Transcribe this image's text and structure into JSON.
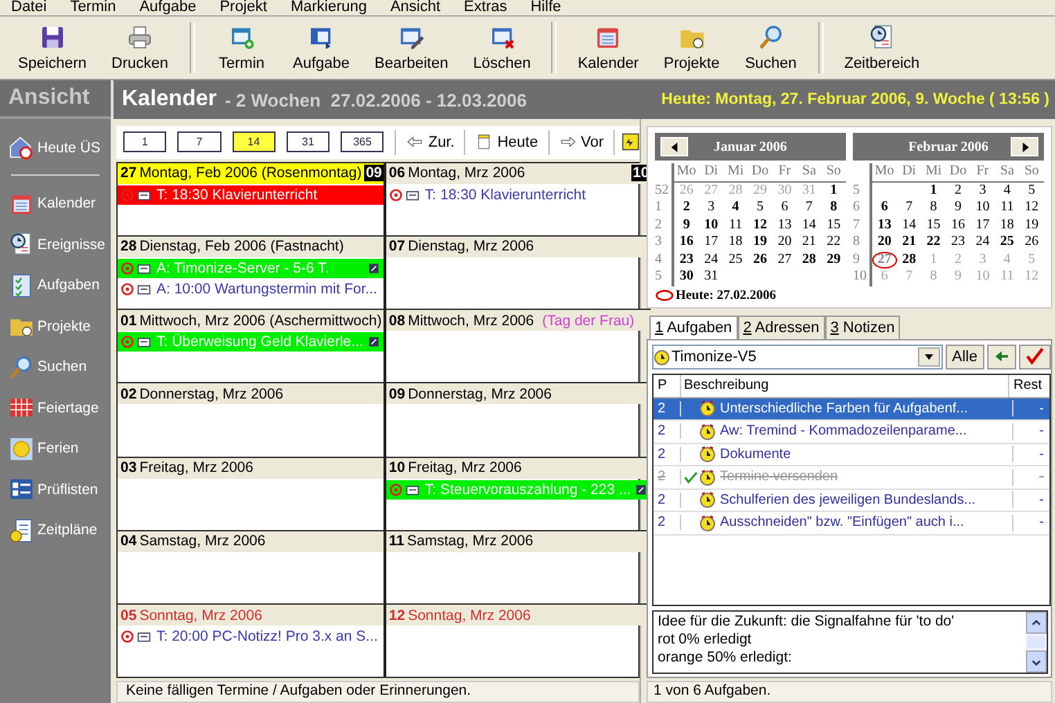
{
  "menu": [
    "Datei",
    "Termin",
    "Aufgabe",
    "Projekt",
    "Markierung",
    "Ansicht",
    "Extras",
    "Hilfe"
  ],
  "toolbar": [
    [
      {
        "label": "Speichern",
        "kind": "disk"
      },
      {
        "label": "Drucken",
        "kind": "printer"
      }
    ],
    [
      {
        "label": "Termin",
        "kind": "new"
      },
      {
        "label": "Aufgabe",
        "kind": "task"
      },
      {
        "label": "Bearbeiten",
        "kind": "edit"
      },
      {
        "label": "Löschen",
        "kind": "delete"
      }
    ],
    [
      {
        "label": "Kalender",
        "kind": "calendar"
      },
      {
        "label": "Projekte",
        "kind": "folder"
      },
      {
        "label": "Suchen",
        "kind": "search"
      }
    ],
    [
      {
        "label": "Zeitbereich",
        "kind": "clock"
      }
    ]
  ],
  "sidebar": {
    "title": "Ansicht",
    "groups": [
      [
        {
          "label": "Heute ÜS",
          "kind": "house"
        }
      ],
      [
        {
          "label": "Kalender",
          "kind": "calendar"
        },
        {
          "label": "Ereignisse",
          "kind": "clock"
        },
        {
          "label": "Aufgaben",
          "kind": "checklist"
        },
        {
          "label": "Projekte",
          "kind": "folder"
        },
        {
          "label": "Suchen",
          "kind": "search"
        },
        {
          "label": "Feiertage",
          "kind": "grid"
        },
        {
          "label": "Ferien",
          "kind": "sun"
        },
        {
          "label": "Prüflisten",
          "kind": "list"
        },
        {
          "label": "Zeitpläne",
          "kind": "page"
        }
      ]
    ]
  },
  "header": {
    "title": "Kalender",
    "subtitle": "- 2 Wochen  27.02.2006 - 12.03.2006",
    "today": "Heute: Montag, 27. Februar 2006, 9. Woche ( 13:56 )"
  },
  "calendar": {
    "ranges": [
      {
        "label": "1",
        "selected": false
      },
      {
        "label": "7",
        "selected": false
      },
      {
        "label": "14",
        "selected": true
      },
      {
        "label": "31",
        "selected": false
      },
      {
        "label": "365",
        "selected": false
      }
    ],
    "nav": [
      {
        "label": "Zur.",
        "kind": "back"
      },
      {
        "label": "Heute",
        "kind": "today"
      },
      {
        "label": "Vor",
        "kind": "forward"
      }
    ],
    "columns": [
      [
        {
          "num": "27",
          "label": "Montag, Feb 2006 (Rosenmontag)",
          "kind": "today",
          "week": "09",
          "entries": [
            {
              "text": "T: 18:30 Klavierunterricht",
              "color": "#ff0000",
              "flag": false
            }
          ]
        },
        {
          "num": "28",
          "label": "Dienstag, Feb 2006 (Fastnacht)",
          "kind": "weekday",
          "entries": [
            {
              "text": "A: Timonize-Server - 5-6 T.",
              "color": "#00ee00",
              "flag": true
            },
            {
              "text": "A: 10:00 Wartungstermin mit For...",
              "flag": false
            }
          ]
        },
        {
          "num": "01",
          "label": "Mittwoch, Mrz 2006 (Aschermittwoch)",
          "kind": "weekday",
          "entries": [
            {
              "text": "T: Überweisung Geld Klavierle...",
              "color": "#00ee00",
              "flag": true
            }
          ]
        },
        {
          "num": "02",
          "label": "Donnerstag, Mrz 2006",
          "kind": "weekday"
        },
        {
          "num": "03",
          "label": "Freitag, Mrz 2006",
          "kind": "weekday"
        },
        {
          "num": "04",
          "label": "Samstag, Mrz 2006",
          "kind": "weekday"
        },
        {
          "num": "05",
          "label": "Sonntag, Mrz 2006",
          "kind": "sunday",
          "entries": [
            {
              "text": "T: 20:00 PC-Notizz! Pro 3.x an S...",
              "flag": false
            }
          ]
        }
      ],
      [
        {
          "num": "06",
          "label": "Montag, Mrz 2006",
          "kind": "weekday",
          "week": "10",
          "entries": [
            {
              "text": "T: 18:30 Klavierunterricht",
              "flag": false
            }
          ]
        },
        {
          "num": "07",
          "label": "Dienstag, Mrz 2006",
          "kind": "weekday"
        },
        {
          "num": "08",
          "label": "Mittwoch, Mrz 2006",
          "kind": "weekday",
          "holiday": "(Tag der Frau)"
        },
        {
          "num": "09",
          "label": "Donnerstag, Mrz 2006",
          "kind": "weekday"
        },
        {
          "num": "10",
          "label": "Freitag, Mrz 2006",
          "kind": "weekday",
          "entries": [
            {
              "text": "T: Steuervorauszahlung - 223 ...",
              "color": "#00ee00",
              "flag": true
            }
          ]
        },
        {
          "num": "11",
          "label": "Samstag, Mrz 2006",
          "kind": "weekday"
        },
        {
          "num": "12",
          "label": "Sonntag, Mrz 2006",
          "kind": "sunday"
        }
      ]
    ],
    "status": "Keine fälligen Termine / Aufgaben oder Erinnerungen."
  },
  "mini_calendars": [
    {
      "title": "Januar 2006",
      "prev_button": true,
      "weekdays": [
        "Mo",
        "Di",
        "Mi",
        "Do",
        "Fr",
        "Sa",
        "So"
      ],
      "weeks": [
        {
          "week": "52",
          "days": [
            {
              "d": "26",
              "kind": "other"
            },
            {
              "d": "27",
              "kind": "other"
            },
            {
              "d": "28",
              "kind": "other"
            },
            {
              "d": "29",
              "kind": "other"
            },
            {
              "d": "30",
              "kind": "other"
            },
            {
              "d": "31",
              "kind": "other"
            },
            {
              "d": "1",
              "kind": "bold"
            }
          ]
        },
        {
          "week": "1",
          "days": [
            {
              "d": "2",
              "kind": "bold"
            },
            {
              "d": "3",
              "kind": "plain"
            },
            {
              "d": "4",
              "kind": "bold"
            },
            {
              "d": "5",
              "kind": "plain"
            },
            {
              "d": "6",
              "kind": "plain"
            },
            {
              "d": "7",
              "kind": "plain"
            },
            {
              "d": "8",
              "kind": "bold"
            }
          ]
        },
        {
          "week": "2",
          "days": [
            {
              "d": "9",
              "kind": "bold"
            },
            {
              "d": "10",
              "kind": "bold"
            },
            {
              "d": "11",
              "kind": "plain"
            },
            {
              "d": "12",
              "kind": "bold"
            },
            {
              "d": "13",
              "kind": "plain"
            },
            {
              "d": "14",
              "kind": "plain"
            },
            {
              "d": "15",
              "kind": "plain"
            }
          ]
        },
        {
          "week": "3",
          "days": [
            {
              "d": "16",
              "kind": "bold"
            },
            {
              "d": "17",
              "kind": "plain"
            },
            {
              "d": "18",
              "kind": "plain"
            },
            {
              "d": "19",
              "kind": "bold"
            },
            {
              "d": "20",
              "kind": "plain"
            },
            {
              "d": "21",
              "kind": "plain"
            },
            {
              "d": "22",
              "kind": "plain"
            }
          ]
        },
        {
          "week": "4",
          "days": [
            {
              "d": "23",
              "kind": "bold"
            },
            {
              "d": "24",
              "kind": "plain"
            },
            {
              "d": "25",
              "kind": "plain"
            },
            {
              "d": "26",
              "kind": "bold"
            },
            {
              "d": "27",
              "kind": "plain"
            },
            {
              "d": "28",
              "kind": "bold"
            },
            {
              "d": "29",
              "kind": "bold"
            }
          ]
        },
        {
          "week": "5",
          "days": [
            {
              "d": "30",
              "kind": "bold"
            },
            {
              "d": "31",
              "kind": "plain"
            }
          ]
        }
      ]
    },
    {
      "title": "Februar 2006",
      "next_button": true,
      "weekdays": [
        "Mo",
        "Di",
        "Mi",
        "Do",
        "Fr",
        "Sa",
        "So"
      ],
      "weeks": [
        {
          "week": "5",
          "leading_gap": true,
          "days": [
            {
              "d": "1",
              "kind": "bold"
            },
            {
              "d": "2",
              "kind": "plain"
            },
            {
              "d": "3",
              "kind": "plain"
            },
            {
              "d": "4",
              "kind": "plain"
            },
            {
              "d": "5",
              "kind": "plain"
            }
          ]
        },
        {
          "week": "6",
          "days": [
            {
              "d": "6",
              "kind": "bold"
            },
            {
              "d": "7",
              "kind": "plain"
            },
            {
              "d": "8",
              "kind": "plain"
            },
            {
              "d": "9",
              "kind": "plain"
            },
            {
              "d": "10",
              "kind": "plain"
            },
            {
              "d": "11",
              "kind": "plain"
            },
            {
              "d": "12",
              "kind": "plain"
            }
          ]
        },
        {
          "week": "7",
          "days": [
            {
              "d": "13",
              "kind": "bold"
            },
            {
              "d": "14",
              "kind": "plain"
            },
            {
              "d": "15",
              "kind": "plain"
            },
            {
              "d": "16",
              "kind": "plain"
            },
            {
              "d": "17",
              "kind": "plain"
            },
            {
              "d": "18",
              "kind": "plain"
            },
            {
              "d": "19",
              "kind": "plain"
            }
          ]
        },
        {
          "week": "8",
          "days": [
            {
              "d": "20",
              "kind": "bold"
            },
            {
              "d": "21",
              "kind": "bold"
            },
            {
              "d": "22",
              "kind": "bold"
            },
            {
              "d": "23",
              "kind": "plain"
            },
            {
              "d": "24",
              "kind": "plain"
            },
            {
              "d": "25",
              "kind": "bold"
            },
            {
              "d": "26",
              "kind": "plain"
            }
          ]
        },
        {
          "week": "9",
          "days": [
            {
              "d": "27",
              "kind": "today"
            },
            {
              "d": "28",
              "kind": "bold"
            },
            {
              "d": "1",
              "kind": "other"
            },
            {
              "d": "2",
              "kind": "other"
            },
            {
              "d": "3",
              "kind": "other"
            },
            {
              "d": "4",
              "kind": "other"
            },
            {
              "d": "5",
              "kind": "other"
            }
          ]
        },
        {
          "week": "10",
          "days": [
            {
              "d": "6",
              "kind": "other"
            },
            {
              "d": "7",
              "kind": "other"
            },
            {
              "d": "8",
              "kind": "other"
            },
            {
              "d": "9",
              "kind": "other"
            },
            {
              "d": "10",
              "kind": "other"
            },
            {
              "d": "11",
              "kind": "other"
            },
            {
              "d": "12",
              "kind": "other"
            }
          ]
        }
      ]
    }
  ],
  "today_legend": "Heute: 27.02.2006",
  "tabs": [
    {
      "key": "1",
      "label": "Aufgaben",
      "selected": true
    },
    {
      "key": "2",
      "label": "Adressen",
      "selected": false
    },
    {
      "key": "3",
      "label": "Notizen",
      "selected": false
    }
  ],
  "tasks": {
    "project": "Timonize-V5",
    "filter_button": "Alle",
    "columns": [
      "P",
      "Beschreibung",
      "Rest"
    ],
    "rows": [
      {
        "p": "2",
        "text": "Unterschiedliche Farben für Aufgabenf...",
        "rest": "-",
        "selected": true,
        "done": false
      },
      {
        "p": "2",
        "text": "Aw: Tremind - Kommadozeilenparame...",
        "rest": "-",
        "selected": false,
        "done": false
      },
      {
        "p": "2",
        "text": "Dokumente",
        "rest": "-",
        "selected": false,
        "done": false
      },
      {
        "p": "2",
        "text": "Termine versenden",
        "rest": "-",
        "selected": false,
        "done": true
      },
      {
        "p": "2",
        "text": "Schulferien des jeweiligen Bundeslands...",
        "rest": "-",
        "selected": false,
        "done": false
      },
      {
        "p": "2",
        "text": "Ausschneiden\" bzw. \"Einfügen\" auch i...",
        "rest": "-",
        "selected": false,
        "done": false
      }
    ],
    "notes": [
      "Idee für die Zukunft: die Signalfahne für 'to do'",
      "rot 0% erledigt",
      "orange 50% erledigt:"
    ],
    "status": "1 von 6 Aufgaben."
  }
}
